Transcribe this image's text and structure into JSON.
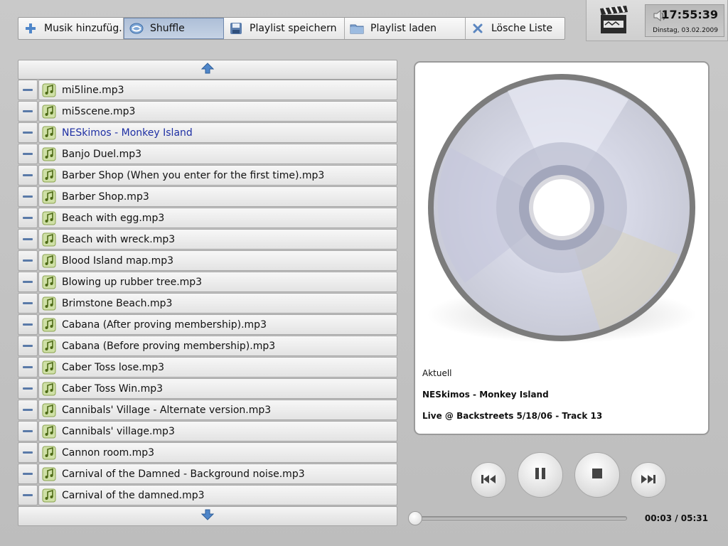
{
  "toolbar": {
    "add_music": "Musik hinzufüg..",
    "shuffle": "Shuffle",
    "save_playlist": "Playlist speichern",
    "load_playlist": "Playlist laden",
    "clear_list": "Lösche Liste"
  },
  "clock": {
    "time": "17:55:39",
    "date": "Dinstag, 03.02.2009"
  },
  "playlist": {
    "tracks": [
      "mi5line.mp3",
      "mi5scene.mp3",
      "NESkimos - Monkey Island",
      "Banjo Duel.mp3",
      "Barber Shop (When you enter for the first time).mp3",
      "Barber Shop.mp3",
      "Beach with egg.mp3",
      "Beach with wreck.mp3",
      "Blood Island map.mp3",
      "Blowing up rubber tree.mp3",
      "Brimstone Beach.mp3",
      "Cabana (After proving membership).mp3",
      "Cabana (Before proving membership).mp3",
      "Caber Toss lose.mp3",
      "Caber Toss Win.mp3",
      "Cannibals' Village - Alternate version.mp3",
      "Cannibals' village.mp3",
      "Cannon room.mp3",
      "Carnival of the Damned - Background noise.mp3",
      "Carnival of the damned.mp3"
    ]
  },
  "now_playing": {
    "label": "Aktuell",
    "artist_title": "NESkimos - Monkey Island",
    "album_track": "Live @ Backstreets 5/18/06 - Track 13"
  },
  "player": {
    "time_readout": "00:03 / 05:31",
    "progress_fraction": 0.009
  },
  "colors": {
    "accent_blue": "#4f86c9",
    "playing_text": "#1e2fa3"
  },
  "icons": {
    "add": "plus-icon",
    "shuffle": "shuffle-icon",
    "save": "floppy-disk-icon",
    "load": "folder-icon",
    "clear": "x-icon",
    "track": "music-note-icon",
    "remove": "minus-icon"
  }
}
